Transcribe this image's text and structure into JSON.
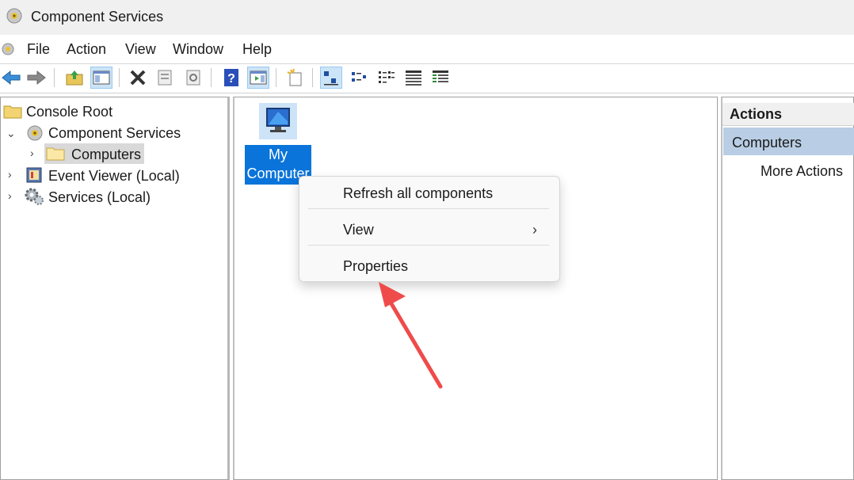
{
  "window": {
    "title": "Component Services"
  },
  "menubar": [
    "File",
    "Action",
    "View",
    "Window",
    "Help"
  ],
  "tree": {
    "root": "Console Root",
    "component_services": "Component Services",
    "computers": "Computers",
    "event_viewer": "Event Viewer (Local)",
    "services": "Services (Local)"
  },
  "content": {
    "item_label_line1": "My",
    "item_label_line2": "Computer"
  },
  "context_menu": {
    "refresh": "Refresh all components",
    "view": "View",
    "view_chevron": "›",
    "properties": "Properties"
  },
  "actions": {
    "header": "Actions",
    "section": "Computers",
    "more": "More Actions"
  },
  "colors": {
    "selection": "#0a74da",
    "actions_section": "#b9cee5",
    "annotation_arrow": "#ef4b4b"
  }
}
